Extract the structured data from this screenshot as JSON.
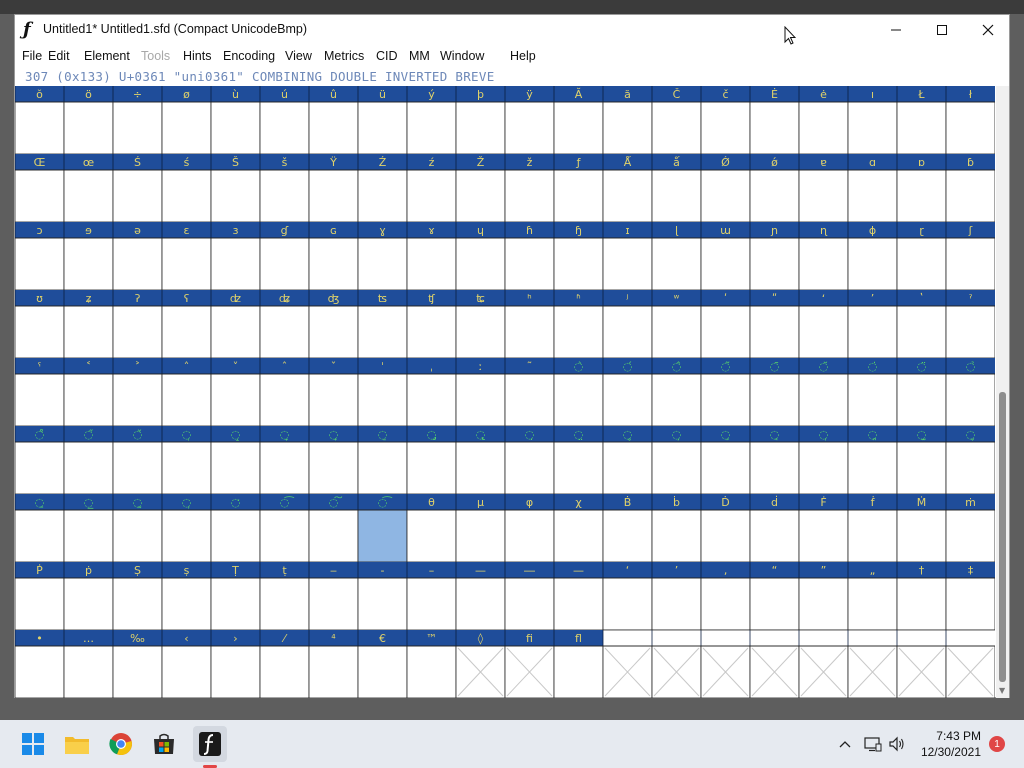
{
  "window": {
    "title": "Untitled1*  Untitled1.sfd (Compact UnicodeBmp)"
  },
  "menu": [
    "File",
    "Edit",
    "Element",
    "Tools",
    "Hints",
    "Encoding",
    "View",
    "Metrics",
    "CID",
    "MM",
    "Window",
    "Help"
  ],
  "menu_disabled": [
    "Tools"
  ],
  "info_line": "307 (0x133) U+0361 \"uni0361\" COMBINING DOUBLE INVERTED BREVE",
  "font_view": {
    "rows": [
      [
        "ŏ",
        "ö",
        "÷",
        "ø",
        "ù",
        "ú",
        "û",
        "ü",
        "ý",
        "þ",
        "ÿ",
        "Ă",
        "ă",
        "Č",
        "č",
        "Ė",
        "ė",
        "ı",
        "Ł",
        "ł"
      ],
      [
        "Œ",
        "œ",
        "Ś",
        "ś",
        "Š",
        "š",
        "Ÿ",
        "Ź",
        "ź",
        "Ž",
        "ž",
        "ƒ",
        "Ǻ",
        "ǻ",
        "Ǿ",
        "ǿ",
        "ɐ",
        "ɑ",
        "ɒ",
        "ɓ"
      ],
      [
        "ɔ",
        "ɘ",
        "ə",
        "ɛ",
        "ɜ",
        "ɠ",
        "ɢ",
        "ɣ",
        "ɤ",
        "ɥ",
        "ɦ",
        "ɧ",
        "ɪ",
        "ɭ",
        "ɯ",
        "ɲ",
        "ɳ",
        "ɸ",
        "ɽ",
        "ʃ"
      ],
      [
        "ʊ",
        "ʑ",
        "ʔ",
        "ʕ",
        "ʣ",
        "ʥ",
        "ʤ",
        "ʦ",
        "ʧ",
        "ʨ",
        "ʰ",
        "ʱ",
        "ʲ",
        "ʷ",
        "ʹ",
        "ʺ",
        "ʻ",
        "ʼ",
        "ʽ",
        "ˀ"
      ],
      [
        "ˁ",
        "˂",
        "˃",
        "˄",
        "˅",
        "ˆ",
        "ˇ",
        "ˈ",
        "ˌ",
        "ː",
        "˜",
        "◌̀",
        "◌́",
        "◌̂",
        "◌̃",
        "◌̄",
        "◌̆",
        "◌̇",
        "◌̈",
        "◌̉"
      ],
      [
        "◌̊",
        "◌̋",
        "◌̌",
        "◌̜",
        "◌̝",
        "◌̞",
        "◌̟",
        "◌̠",
        "◌̡",
        "◌̢",
        "◌̣",
        "◌̤",
        "◌̥",
        "◌̦",
        "◌̧",
        "◌̨",
        "◌̩",
        "◌̪",
        "◌̫",
        "◌̬"
      ],
      [
        "◌̱",
        "◌̲",
        "◌̰",
        "◌̹",
        "◌̒",
        "◌͡",
        "◌͠",
        "◌͡",
        "θ",
        "μ",
        "φ",
        "χ",
        "Ḃ",
        "ḃ",
        "Ḋ",
        "ḋ",
        "Ḟ",
        "ḟ",
        "Ṁ",
        "ṁ"
      ],
      [
        "Ṗ",
        "ṗ",
        "Ṣ",
        "ṣ",
        "Ṭ",
        "ṭ",
        "‒",
        "‐",
        "–",
        "—",
        "―",
        "—",
        "‘",
        "’",
        "‚",
        "“",
        "”",
        "„",
        "†",
        "‡"
      ],
      [
        "•",
        "…",
        "‰",
        "‹",
        "›",
        "⁄",
        "⁴",
        "€",
        "™",
        "◊",
        "ﬁ",
        "ﬂ",
        "",
        "",
        "",
        "",
        "",
        "",
        "",
        ""
      ]
    ],
    "selected": {
      "row": 6,
      "col": 7
    },
    "empty_cells": [
      {
        "row": 8,
        "col": 9
      },
      {
        "row": 8,
        "col": 10
      }
    ],
    "crossed_cells_row8_from": 12,
    "header_color": "#1f4d9a",
    "glyph_colors": {
      "normal": "#e0d26a",
      "combining": "#56d46a"
    },
    "selected_color": "#8fb6e3"
  },
  "taskbar": {
    "time": "7:43 PM",
    "date": "12/30/2021",
    "notification_count": "1",
    "apps": [
      "start-icon",
      "file-explorer-icon",
      "chrome-icon",
      "store-icon",
      "fontforge-icon"
    ]
  }
}
